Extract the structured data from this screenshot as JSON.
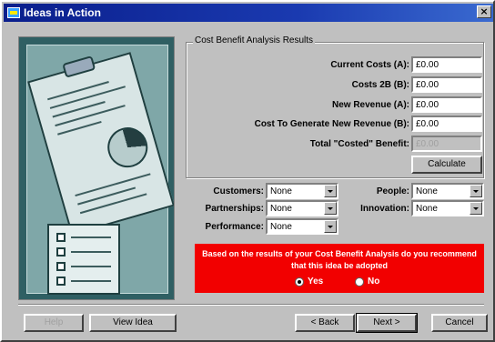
{
  "window": {
    "title": "Ideas in Action",
    "close_glyph": "×"
  },
  "form": {
    "group_title": "Cost Benefit Analysis Results",
    "current_costs": {
      "label": "Current Costs (A):",
      "value": "£0.00"
    },
    "costs_2b": {
      "label": "Costs 2B (B):",
      "value": "£0.00"
    },
    "new_revenue": {
      "label": "New Revenue (A):",
      "value": "£0.00"
    },
    "cost_to_generate": {
      "label": "Cost To Generate New Revenue (B):",
      "value": "£0.00"
    },
    "total_benefit": {
      "label": "Total \"Costed\" Benefit:",
      "value": "£0.00"
    },
    "calculate_label": "Calculate"
  },
  "impact": {
    "customers": {
      "label": "Customers:",
      "value": "None"
    },
    "partnerships": {
      "label": "Partnerships:",
      "value": "None"
    },
    "performance": {
      "label": "Performance:",
      "value": "None"
    },
    "people": {
      "label": "People:",
      "value": "None"
    },
    "innovation": {
      "label": "Innovation:",
      "value": "None"
    }
  },
  "recommendation": {
    "text": "Based on the results of your Cost Benefit Analysis do you recommend that this idea be adopted",
    "yes_label": "Yes",
    "no_label": "No",
    "selected": "Yes",
    "panel_color": "#f20000"
  },
  "footer": {
    "help_label": "Help",
    "view_idea_label": "View Idea",
    "back_label": "< Back",
    "next_label": "Next >",
    "cancel_label": "Cancel"
  },
  "icons": {
    "app": "ideas-app-icon",
    "close": "close-icon"
  }
}
